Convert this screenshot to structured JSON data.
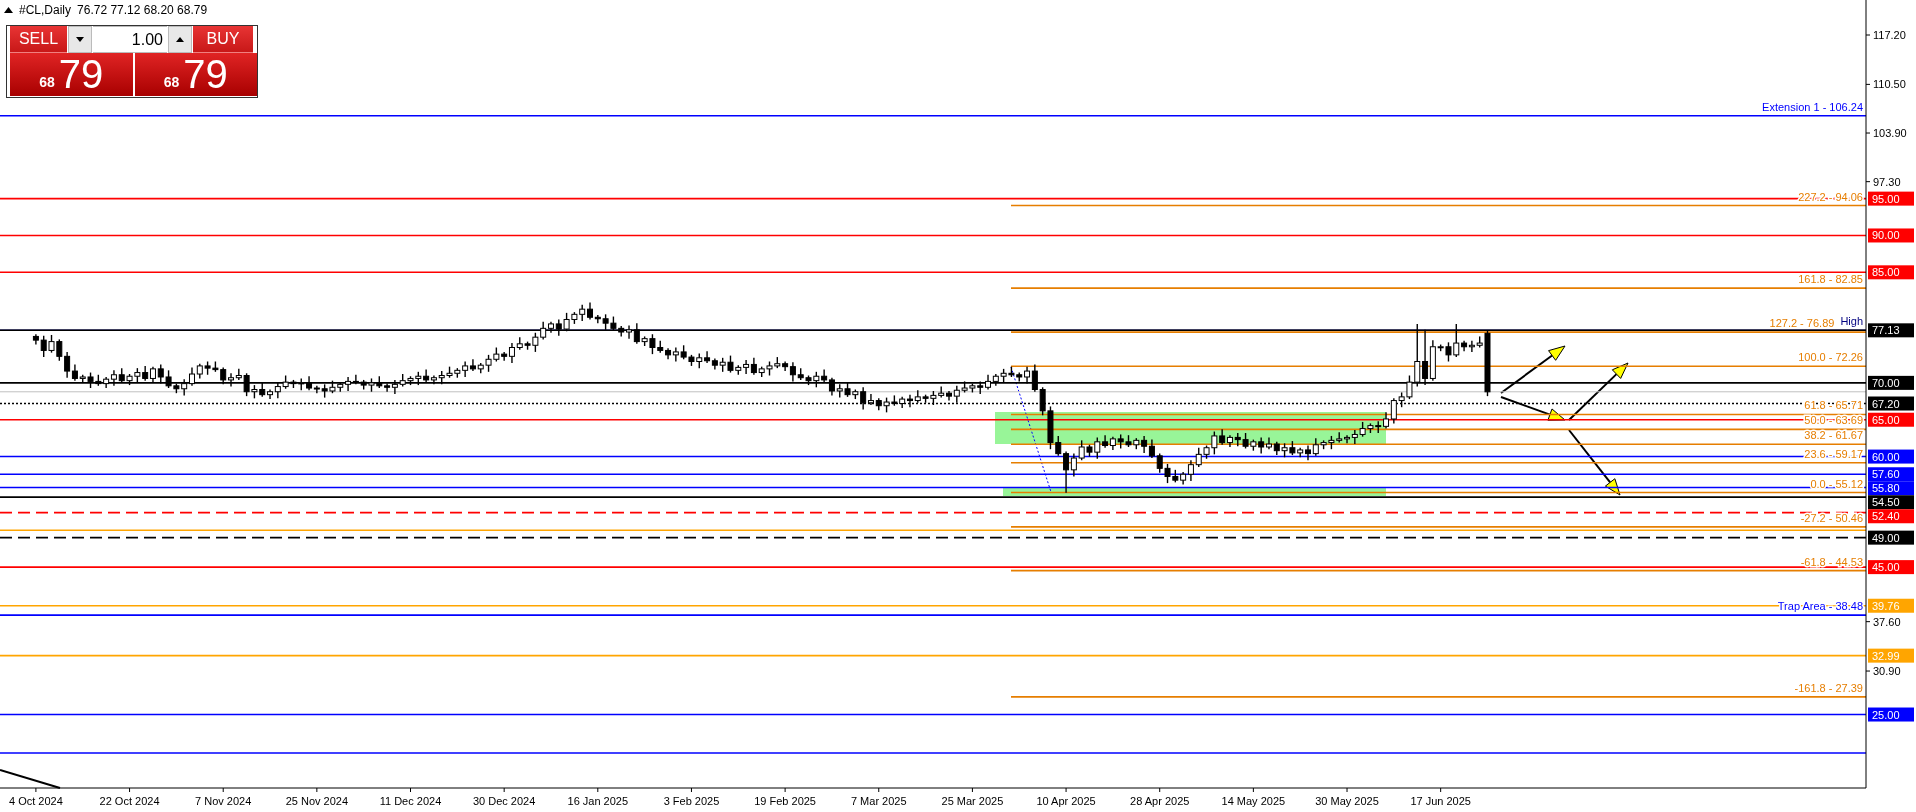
{
  "header": {
    "symbol": "#CL,Daily",
    "ohlc": "76.72 77.12 68.20 68.79"
  },
  "trade_panel": {
    "sell_label": "SELL",
    "buy_label": "BUY",
    "lot": "1.00",
    "sell_price": {
      "big_figure": "68",
      "pips": "79"
    },
    "buy_price": {
      "big_figure": "68",
      "pips": "79"
    }
  },
  "chart": {
    "fib_labels": [
      "227.2 - 94.06",
      "161.8 - 82.85",
      "127.2 - 76.89",
      "100.0 - 72.26",
      "61.8 - 65.71",
      "50.0 - 63.69",
      "38.2 - 61.67",
      "23.6 - 59.17",
      "0.0 - 55.12",
      "-27.2 - 50.46",
      "-61.8 - 44.53",
      "-161.8 - 27.39"
    ],
    "chart_data": {
      "type": "candlestick",
      "ylim": [
        15.03,
        121.95
      ],
      "categories": [
        "4 Oct 2024",
        null,
        null,
        null,
        null,
        null,
        null,
        null,
        null,
        null,
        null,
        null,
        "22 Oct 2024",
        null,
        null,
        null,
        null,
        null,
        null,
        null,
        null,
        null,
        null,
        null,
        "7 Nov 2024",
        null,
        null,
        null,
        null,
        null,
        null,
        null,
        null,
        null,
        null,
        null,
        "25 Nov 2024",
        null,
        null,
        null,
        null,
        null,
        null,
        null,
        null,
        null,
        null,
        null,
        "11 Dec 2024",
        null,
        null,
        null,
        null,
        null,
        null,
        null,
        null,
        null,
        null,
        null,
        "30 Dec 2024",
        null,
        null,
        null,
        null,
        null,
        null,
        null,
        null,
        null,
        null,
        null,
        "16 Jan 2025",
        null,
        null,
        null,
        null,
        null,
        null,
        null,
        null,
        null,
        null,
        null,
        "3 Feb 2025",
        null,
        null,
        null,
        null,
        null,
        null,
        null,
        null,
        null,
        null,
        null,
        "19 Feb 2025",
        null,
        null,
        null,
        null,
        null,
        null,
        null,
        null,
        null,
        null,
        null,
        "7 Mar 2025",
        null,
        null,
        null,
        null,
        null,
        null,
        null,
        null,
        null,
        null,
        null,
        "25 Mar 2025",
        null,
        null,
        null,
        null,
        null,
        null,
        null,
        null,
        null,
        null,
        null,
        "10 Apr 2025",
        null,
        null,
        null,
        null,
        null,
        null,
        null,
        null,
        null,
        null,
        null,
        "28 Apr 2025",
        null,
        null,
        null,
        null,
        null,
        null,
        null,
        null,
        null,
        null,
        null,
        "14 May 2025",
        null,
        null,
        null,
        null,
        null,
        null,
        null,
        null,
        null,
        null,
        null,
        "30 May 2025",
        null,
        null,
        null,
        null,
        null,
        null,
        null,
        null,
        null,
        null,
        null,
        "17 Jun 2025",
        null,
        null,
        null,
        null,
        null,
        null,
        null,
        null,
        null,
        null,
        null,
        null,
        null,
        null,
        null,
        null,
        null,
        null,
        null,
        null,
        null,
        null,
        null,
        null,
        null,
        null,
        null,
        null,
        null,
        null,
        null,
        null,
        null,
        null,
        null,
        null,
        null,
        null,
        null,
        null,
        null,
        null,
        null,
        null,
        null,
        null,
        null,
        null,
        null,
        null,
        null,
        null,
        null,
        null
      ],
      "yticks": [
        {
          "value": 117.2,
          "label": "117.20"
        },
        {
          "value": 110.5,
          "label": "110.50"
        },
        {
          "value": 103.9,
          "label": "103.90"
        },
        {
          "value": 97.3,
          "label": "97.30"
        },
        {
          "value": 37.6,
          "label": "37.60"
        },
        {
          "value": 30.9,
          "label": "30.90"
        }
      ],
      "ohlc": [
        [
          76.3,
          76.6,
          75.2,
          75.8
        ],
        [
          75.8,
          76.4,
          73.5,
          74.4
        ],
        [
          74.4,
          76.5,
          74.1,
          75.6
        ],
        [
          75.6,
          75.9,
          73.0,
          73.6
        ],
        [
          73.6,
          74.2,
          70.7,
          71.6
        ],
        [
          71.6,
          72.5,
          70.3,
          70.6
        ],
        [
          70.6,
          71.1,
          70.0,
          70.8
        ],
        [
          70.8,
          71.4,
          69.3,
          70.2
        ],
        [
          70.2,
          71.1,
          69.6,
          69.9
        ],
        [
          69.9,
          70.8,
          69.3,
          70.5
        ],
        [
          70.5,
          71.7,
          69.6,
          71.1
        ],
        [
          71.1,
          72.0,
          70.0,
          70.3
        ],
        [
          70.3,
          71.2,
          69.7,
          70.9
        ],
        [
          70.9,
          72.0,
          70.0,
          71.4
        ],
        [
          71.4,
          72.3,
          70.3,
          70.6
        ],
        [
          70.6,
          72.2,
          70.0,
          71.9
        ],
        [
          71.9,
          72.5,
          69.9,
          70.8
        ],
        [
          70.8,
          71.7,
          69.3,
          69.6
        ],
        [
          69.6,
          69.9,
          68.6,
          69.2
        ],
        [
          69.2,
          70.5,
          68.3,
          69.9
        ],
        [
          69.9,
          72.1,
          69.6,
          71.2
        ],
        [
          71.2,
          72.6,
          70.6,
          72.3
        ],
        [
          72.3,
          72.9,
          71.1,
          72.0
        ],
        [
          72.0,
          72.9,
          71.5,
          71.8
        ],
        [
          71.8,
          72.1,
          69.8,
          70.4
        ],
        [
          70.4,
          71.3,
          69.5,
          70.7
        ],
        [
          70.7,
          71.9,
          70.4,
          71.0
        ],
        [
          71.0,
          71.3,
          68.2,
          68.8
        ],
        [
          68.8,
          69.7,
          67.9,
          69.1
        ],
        [
          69.1,
          70.0,
          68.1,
          68.4
        ],
        [
          68.4,
          69.1,
          67.8,
          68.8
        ],
        [
          68.8,
          70.1,
          67.9,
          69.5
        ],
        [
          69.5,
          71.0,
          69.2,
          70.1
        ],
        [
          70.1,
          70.4,
          69.3,
          69.9
        ],
        [
          69.9,
          70.6,
          69.0,
          70.0
        ],
        [
          70.0,
          70.9,
          69.0,
          69.3
        ],
        [
          69.3,
          69.6,
          68.6,
          69.2
        ],
        [
          69.2,
          69.8,
          68.0,
          68.9
        ],
        [
          68.9,
          70.3,
          68.6,
          69.4
        ],
        [
          69.4,
          70.1,
          68.8,
          69.8
        ],
        [
          69.8,
          70.8,
          68.9,
          70.2
        ],
        [
          70.2,
          71.1,
          69.8,
          70.1
        ],
        [
          70.1,
          70.4,
          69.1,
          69.7
        ],
        [
          69.7,
          70.6,
          68.8,
          70.0
        ],
        [
          70.0,
          70.9,
          69.3,
          69.6
        ],
        [
          69.6,
          69.9,
          68.8,
          69.4
        ],
        [
          69.4,
          70.4,
          68.5,
          69.8
        ],
        [
          69.8,
          71.2,
          69.5,
          70.3
        ],
        [
          70.3,
          70.9,
          69.7,
          70.6
        ],
        [
          70.6,
          71.5,
          69.7,
          70.9
        ],
        [
          70.9,
          71.8,
          70.1,
          70.4
        ],
        [
          70.4,
          71.0,
          69.8,
          70.7
        ],
        [
          70.7,
          71.6,
          69.8,
          71.0
        ],
        [
          71.0,
          72.2,
          70.7,
          71.3
        ],
        [
          71.3,
          72.0,
          70.7,
          71.7
        ],
        [
          71.7,
          72.9,
          70.8,
          72.3
        ],
        [
          72.3,
          73.2,
          71.6,
          71.9
        ],
        [
          71.9,
          72.7,
          71.3,
          72.4
        ],
        [
          72.4,
          73.8,
          71.5,
          73.2
        ],
        [
          73.2,
          74.8,
          72.9,
          73.9
        ],
        [
          73.9,
          74.2,
          73.0,
          73.6
        ],
        [
          73.6,
          75.4,
          72.7,
          74.8
        ],
        [
          74.8,
          76.2,
          74.5,
          75.3
        ],
        [
          75.3,
          75.6,
          74.5,
          75.1
        ],
        [
          75.1,
          76.8,
          74.2,
          76.2
        ],
        [
          76.2,
          78.3,
          75.9,
          77.4
        ],
        [
          77.4,
          78.3,
          76.8,
          78.0
        ],
        [
          78.0,
          78.6,
          76.4,
          77.3
        ],
        [
          77.3,
          79.5,
          77.0,
          78.6
        ],
        [
          78.6,
          79.6,
          78.0,
          79.3
        ],
        [
          79.3,
          80.6,
          78.4,
          80.0
        ],
        [
          80.0,
          80.9,
          78.6,
          78.9
        ],
        [
          78.9,
          79.2,
          78.1,
          78.7
        ],
        [
          78.7,
          79.3,
          77.2,
          78.1
        ],
        [
          78.1,
          79.0,
          77.1,
          77.4
        ],
        [
          77.4,
          77.7,
          76.3,
          76.9
        ],
        [
          76.9,
          77.8,
          76.0,
          77.2
        ],
        [
          77.2,
          78.1,
          75.3,
          75.6
        ],
        [
          75.6,
          76.3,
          75.0,
          76.0
        ],
        [
          76.0,
          76.6,
          73.9,
          74.8
        ],
        [
          74.8,
          75.7,
          74.1,
          74.4
        ],
        [
          74.4,
          74.7,
          73.2,
          73.8
        ],
        [
          73.8,
          74.8,
          72.9,
          74.2
        ],
        [
          74.2,
          75.1,
          73.2,
          73.5
        ],
        [
          73.5,
          73.8,
          72.3,
          72.9
        ],
        [
          72.9,
          74.0,
          72.0,
          73.4
        ],
        [
          73.4,
          74.3,
          72.7,
          73.0
        ],
        [
          73.0,
          73.3,
          71.8,
          72.4
        ],
        [
          72.4,
          73.4,
          71.5,
          72.8
        ],
        [
          72.8,
          73.7,
          71.4,
          71.7
        ],
        [
          71.7,
          72.4,
          71.1,
          72.1
        ],
        [
          72.1,
          73.1,
          71.2,
          72.5
        ],
        [
          72.5,
          73.4,
          71.1,
          71.4
        ],
        [
          71.4,
          72.2,
          70.8,
          71.9
        ],
        [
          71.9,
          72.9,
          71.0,
          72.3
        ],
        [
          72.3,
          73.5,
          72.0,
          72.6
        ],
        [
          72.6,
          72.9,
          71.6,
          72.2
        ],
        [
          72.2,
          72.8,
          70.2,
          71.1
        ],
        [
          71.1,
          72.0,
          70.4,
          70.7
        ],
        [
          70.7,
          71.0,
          69.7,
          70.3
        ],
        [
          70.3,
          71.5,
          69.4,
          70.9
        ],
        [
          70.9,
          71.8,
          70.1,
          70.4
        ],
        [
          70.4,
          70.7,
          68.3,
          68.9
        ],
        [
          68.9,
          69.8,
          68.0,
          69.2
        ],
        [
          69.2,
          70.1,
          68.1,
          68.4
        ],
        [
          68.4,
          69.1,
          67.8,
          68.8
        ],
        [
          68.8,
          69.4,
          66.4,
          67.3
        ],
        [
          67.3,
          68.5,
          67.0,
          67.6
        ],
        [
          67.6,
          67.9,
          66.3,
          66.9
        ],
        [
          66.9,
          68.0,
          66.0,
          67.4
        ],
        [
          67.4,
          68.3,
          66.9,
          67.2
        ],
        [
          67.2,
          68.1,
          66.6,
          67.8
        ],
        [
          67.8,
          68.4,
          66.7,
          67.6
        ],
        [
          67.6,
          69.0,
          67.3,
          68.1
        ],
        [
          68.1,
          68.4,
          67.3,
          67.9
        ],
        [
          67.9,
          68.9,
          67.0,
          68.3
        ],
        [
          68.3,
          69.5,
          68.0,
          68.6
        ],
        [
          68.6,
          68.9,
          67.6,
          68.2
        ],
        [
          68.2,
          69.6,
          67.3,
          69.0
        ],
        [
          69.0,
          70.2,
          68.7,
          69.3
        ],
        [
          69.3,
          69.9,
          68.7,
          69.6
        ],
        [
          69.6,
          70.2,
          68.5,
          69.4
        ],
        [
          69.4,
          71.1,
          69.1,
          70.2
        ],
        [
          70.2,
          71.2,
          69.6,
          70.9
        ],
        [
          70.9,
          71.9,
          70.0,
          71.3
        ],
        [
          71.3,
          72.2,
          70.8,
          71.1
        ],
        [
          71.1,
          71.4,
          70.2,
          70.8
        ],
        [
          70.8,
          72.2,
          69.9,
          71.6
        ],
        [
          71.6,
          72.5,
          68.8,
          69.1
        ],
        [
          69.1,
          69.4,
          65.6,
          66.2
        ],
        [
          66.2,
          66.8,
          61.0,
          61.9
        ],
        [
          61.9,
          62.8,
          60.1,
          60.4
        ],
        [
          60.4,
          60.7,
          55.1,
          58.2
        ],
        [
          58.2,
          60.4,
          57.3,
          59.8
        ],
        [
          59.8,
          62.2,
          59.5,
          61.3
        ],
        [
          61.3,
          61.6,
          60.0,
          60.6
        ],
        [
          60.6,
          62.6,
          59.7,
          62.0
        ],
        [
          62.0,
          62.9,
          61.2,
          61.5
        ],
        [
          61.5,
          62.7,
          60.9,
          62.4
        ],
        [
          62.4,
          63.0,
          61.1,
          62.0
        ],
        [
          62.0,
          62.9,
          61.3,
          61.6
        ],
        [
          61.6,
          62.5,
          61.0,
          62.2
        ],
        [
          62.2,
          62.8,
          60.5,
          61.4
        ],
        [
          61.4,
          62.3,
          59.8,
          60.1
        ],
        [
          60.1,
          60.4,
          57.8,
          58.4
        ],
        [
          58.4,
          59.0,
          56.4,
          57.3
        ],
        [
          57.3,
          58.2,
          56.5,
          56.8
        ],
        [
          56.8,
          57.9,
          56.2,
          57.6
        ],
        [
          57.6,
          59.5,
          56.7,
          58.9
        ],
        [
          58.9,
          61.2,
          58.6,
          60.3
        ],
        [
          60.3,
          61.5,
          59.7,
          61.2
        ],
        [
          61.2,
          63.4,
          60.3,
          62.8
        ],
        [
          62.8,
          63.7,
          61.6,
          61.9
        ],
        [
          61.9,
          62.9,
          61.3,
          62.6
        ],
        [
          62.6,
          63.2,
          61.4,
          62.3
        ],
        [
          62.3,
          63.2,
          61.1,
          61.4
        ],
        [
          61.4,
          62.3,
          60.8,
          62.0
        ],
        [
          62.0,
          62.6,
          60.4,
          61.3
        ],
        [
          61.3,
          62.6,
          61.0,
          61.7
        ],
        [
          61.7,
          62.0,
          60.2,
          60.8
        ],
        [
          60.8,
          61.8,
          59.9,
          61.2
        ],
        [
          61.2,
          62.1,
          60.2,
          60.5
        ],
        [
          60.5,
          61.2,
          59.9,
          60.9
        ],
        [
          60.9,
          61.5,
          59.5,
          60.4
        ],
        [
          60.4,
          62.5,
          60.1,
          61.6
        ],
        [
          61.6,
          62.2,
          61.0,
          61.9
        ],
        [
          61.9,
          62.8,
          61.0,
          62.2
        ],
        [
          62.2,
          63.3,
          61.9,
          62.4
        ],
        [
          62.4,
          62.9,
          61.8,
          62.6
        ],
        [
          62.6,
          63.6,
          61.7,
          63.0
        ],
        [
          63.0,
          64.7,
          62.7,
          63.8
        ],
        [
          63.8,
          64.5,
          63.2,
          64.2
        ],
        [
          64.2,
          64.8,
          63.2,
          64.1
        ],
        [
          64.1,
          66.0,
          63.8,
          65.1
        ],
        [
          65.1,
          67.9,
          64.5,
          67.6
        ],
        [
          67.6,
          68.7,
          66.7,
          68.1
        ],
        [
          68.1,
          71.0,
          67.8,
          70.1
        ],
        [
          70.1,
          78.0,
          69.5,
          72.9
        ],
        [
          72.9,
          77.2,
          69.7,
          70.6
        ],
        [
          70.6,
          75.8,
          70.3,
          74.9
        ],
        [
          74.9,
          75.2,
          74.3,
          74.9
        ],
        [
          74.9,
          75.5,
          72.9,
          73.8
        ],
        [
          73.8,
          78.0,
          73.5,
          75.4
        ],
        [
          75.4,
          75.7,
          74.3,
          74.9
        ],
        [
          74.9,
          75.7,
          74.2,
          75.1
        ],
        [
          75.1,
          76.3,
          74.8,
          75.4
        ],
        [
          76.72,
          77.12,
          68.2,
          68.79
        ],
        null,
        null,
        null,
        null,
        null,
        null,
        null,
        null,
        null,
        null,
        null,
        null,
        null,
        null,
        null,
        null,
        null,
        null,
        null,
        null,
        null,
        null,
        null,
        null,
        null,
        null,
        null,
        null,
        null,
        null,
        null,
        null,
        null,
        null,
        null,
        null,
        null,
        null,
        null,
        null,
        null,
        null,
        null,
        null,
        null,
        null,
        null,
        null
      ],
      "ref_lines": [
        {
          "axis": "y",
          "value": 106.24,
          "color": "#0000ff",
          "label": "Extension 1 - 106.24"
        },
        {
          "axis": "y",
          "value": 95.0,
          "color": "#ff0000",
          "label": "95.00"
        },
        {
          "axis": "y",
          "value": 94.06,
          "color": "#e67e00"
        },
        {
          "axis": "y",
          "value": 90.0,
          "color": "#ff0000",
          "label": "90.00"
        },
        {
          "axis": "y",
          "value": 85.0,
          "color": "#ff0000",
          "label": "85.00"
        },
        {
          "axis": "y",
          "value": 82.85,
          "color": "#e67e00"
        },
        {
          "axis": "y",
          "value": 77.13,
          "color": "#000080",
          "label": "High"
        },
        {
          "axis": "y",
          "value": 77.13,
          "color": "#000000",
          "label": "77.13"
        },
        {
          "axis": "y",
          "value": 76.89,
          "color": "#e67e00"
        },
        {
          "axis": "y",
          "value": 72.26,
          "color": "#e67e00"
        },
        {
          "axis": "y",
          "value": 70.0,
          "color": "#000000",
          "label": "70.00"
        },
        {
          "axis": "y",
          "value": 68.79,
          "color": "#c0c0c0"
        },
        {
          "axis": "y",
          "value": 67.2,
          "color": "#000000",
          "label": "67.20"
        },
        {
          "axis": "y",
          "value": 65.71,
          "color": "#e67e00"
        },
        {
          "axis": "y",
          "value": 65.0,
          "color": "#ff0000",
          "label": "65.00"
        },
        {
          "axis": "y",
          "value": 63.69,
          "color": "#e67e00"
        },
        {
          "axis": "y",
          "value": 61.67,
          "color": "#e67e00"
        },
        {
          "axis": "y",
          "value": 60.0,
          "color": "#0000ff",
          "label": "60.00"
        },
        {
          "axis": "y",
          "value": 59.17,
          "color": "#e67e00"
        },
        {
          "axis": "y",
          "value": 57.6,
          "color": "#0000ff",
          "label": "57.60"
        },
        {
          "axis": "y",
          "value": 55.8,
          "color": "#0000ff",
          "label": "55.80"
        },
        {
          "axis": "y",
          "value": 55.12,
          "color": "#e67e00"
        },
        {
          "axis": "y",
          "value": 54.5,
          "color": "#000000",
          "label": "54.50"
        },
        {
          "axis": "y",
          "value": 52.4,
          "color": "#ff0000",
          "label": "52.40"
        },
        {
          "axis": "y",
          "value": 50.46,
          "color": "#e67e00"
        },
        {
          "axis": "y",
          "value": 50.0,
          "color": "#ffa500"
        },
        {
          "axis": "y",
          "value": 49.0,
          "color": "#000000",
          "label": "49.00"
        },
        {
          "axis": "y",
          "value": 45.0,
          "color": "#ff0000",
          "label": "45.00"
        },
        {
          "axis": "y",
          "value": 44.53,
          "color": "#e67e00"
        },
        {
          "axis": "y",
          "value": 39.76,
          "color": "#ffa500",
          "label": "39.76"
        },
        {
          "axis": "y",
          "value": 38.48,
          "color": "#0000ff",
          "label": "Trap Area - 38.48"
        },
        {
          "axis": "y",
          "value": 32.99,
          "color": "#ffa500",
          "label": "32.99"
        },
        {
          "axis": "y",
          "value": 27.39,
          "color": "#e67e00"
        },
        {
          "axis": "y",
          "value": 25.0,
          "color": "#0000ff",
          "label": "25.00"
        },
        {
          "axis": "y",
          "value": 19.78,
          "color": "#0000ff"
        }
      ]
    }
  }
}
